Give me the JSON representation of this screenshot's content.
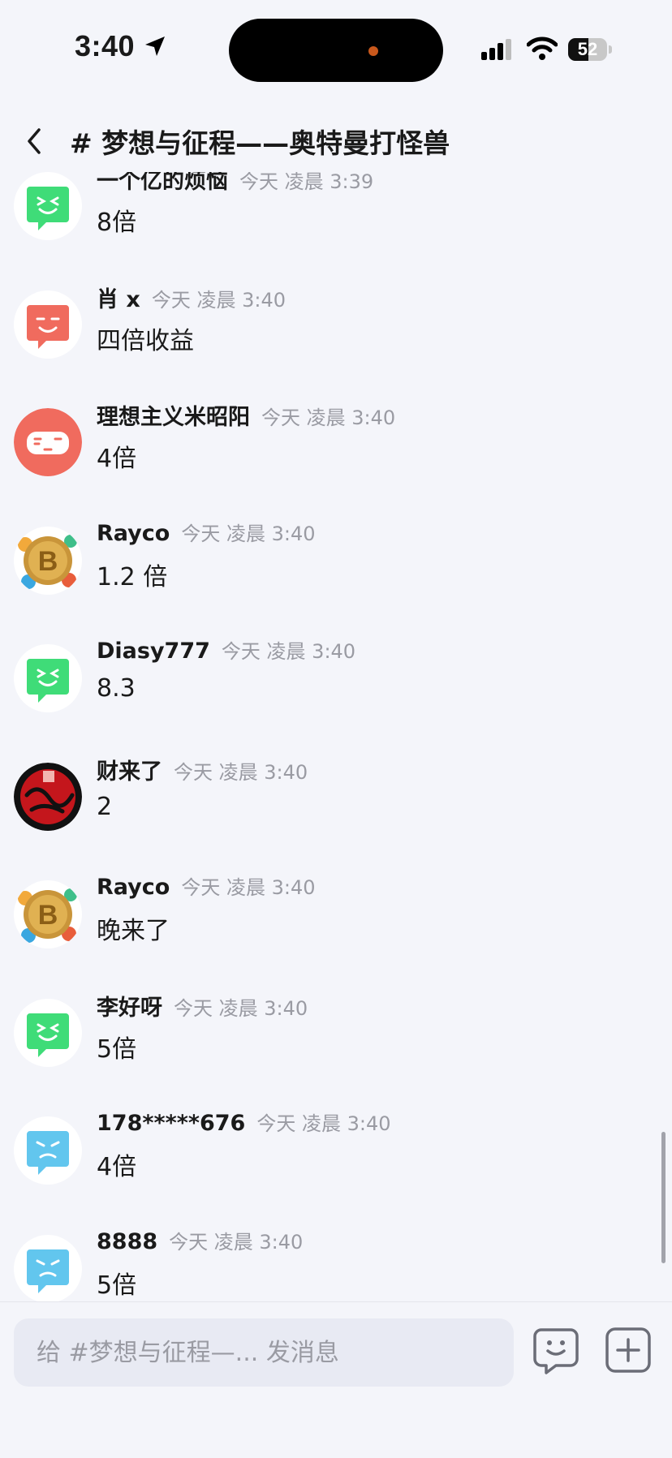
{
  "status_bar": {
    "time": "3:40",
    "battery": "52",
    "battery_level": 0.52,
    "icons": [
      "location-arrow-icon",
      "signal-icon",
      "wifi-icon",
      "battery-icon"
    ]
  },
  "header": {
    "back_icon": "chevron-left-icon",
    "title": "# 梦想与征程——奥特曼打怪兽"
  },
  "messages": [
    {
      "name": "一个亿的烦恼",
      "time": "今天 凌晨 3:39",
      "text": "8倍",
      "avatar": "green-bot"
    },
    {
      "name": "肖 x",
      "time": "今天 凌晨 3:40",
      "text": "四倍收益",
      "avatar": "coral-bot"
    },
    {
      "name": "理想主义米昭阳",
      "time": "今天 凌晨 3:40",
      "text": "4倍",
      "avatar": "coral-pad"
    },
    {
      "name": "Rayco",
      "time": "今天 凌晨 3:40",
      "text": "1.2 倍",
      "avatar": "bitcoin"
    },
    {
      "name": "Diasy777",
      "time": "今天 凌晨 3:40",
      "text": "8.3",
      "avatar": "green-bot"
    },
    {
      "name": "财来了",
      "time": "今天 凌晨 3:40",
      "text": "2",
      "avatar": "red-calligraphy"
    },
    {
      "name": "Rayco",
      "time": "今天 凌晨 3:40",
      "text": "晚来了",
      "avatar": "bitcoin"
    },
    {
      "name": "李好呀",
      "time": "今天 凌晨 3:40",
      "text": "5倍",
      "avatar": "green-bot"
    },
    {
      "name": "178*****676",
      "time": "今天 凌晨 3:40",
      "text": "4倍",
      "avatar": "blue-bot"
    },
    {
      "name": "8888",
      "time": "今天 凌晨 3:40",
      "text": "5倍",
      "avatar": "blue-bot"
    }
  ],
  "input": {
    "placeholder": "给 #梦想与征程—... 发消息",
    "emoji_icon": "emoji-face-icon",
    "plus_icon": "plus-icon"
  },
  "colors": {
    "background": "#f4f5fa",
    "green_avatar": "#3fdc78",
    "coral_avatar": "#f06b5e",
    "blue_avatar": "#62c6ee",
    "timestamp": "#9a9ba3"
  }
}
